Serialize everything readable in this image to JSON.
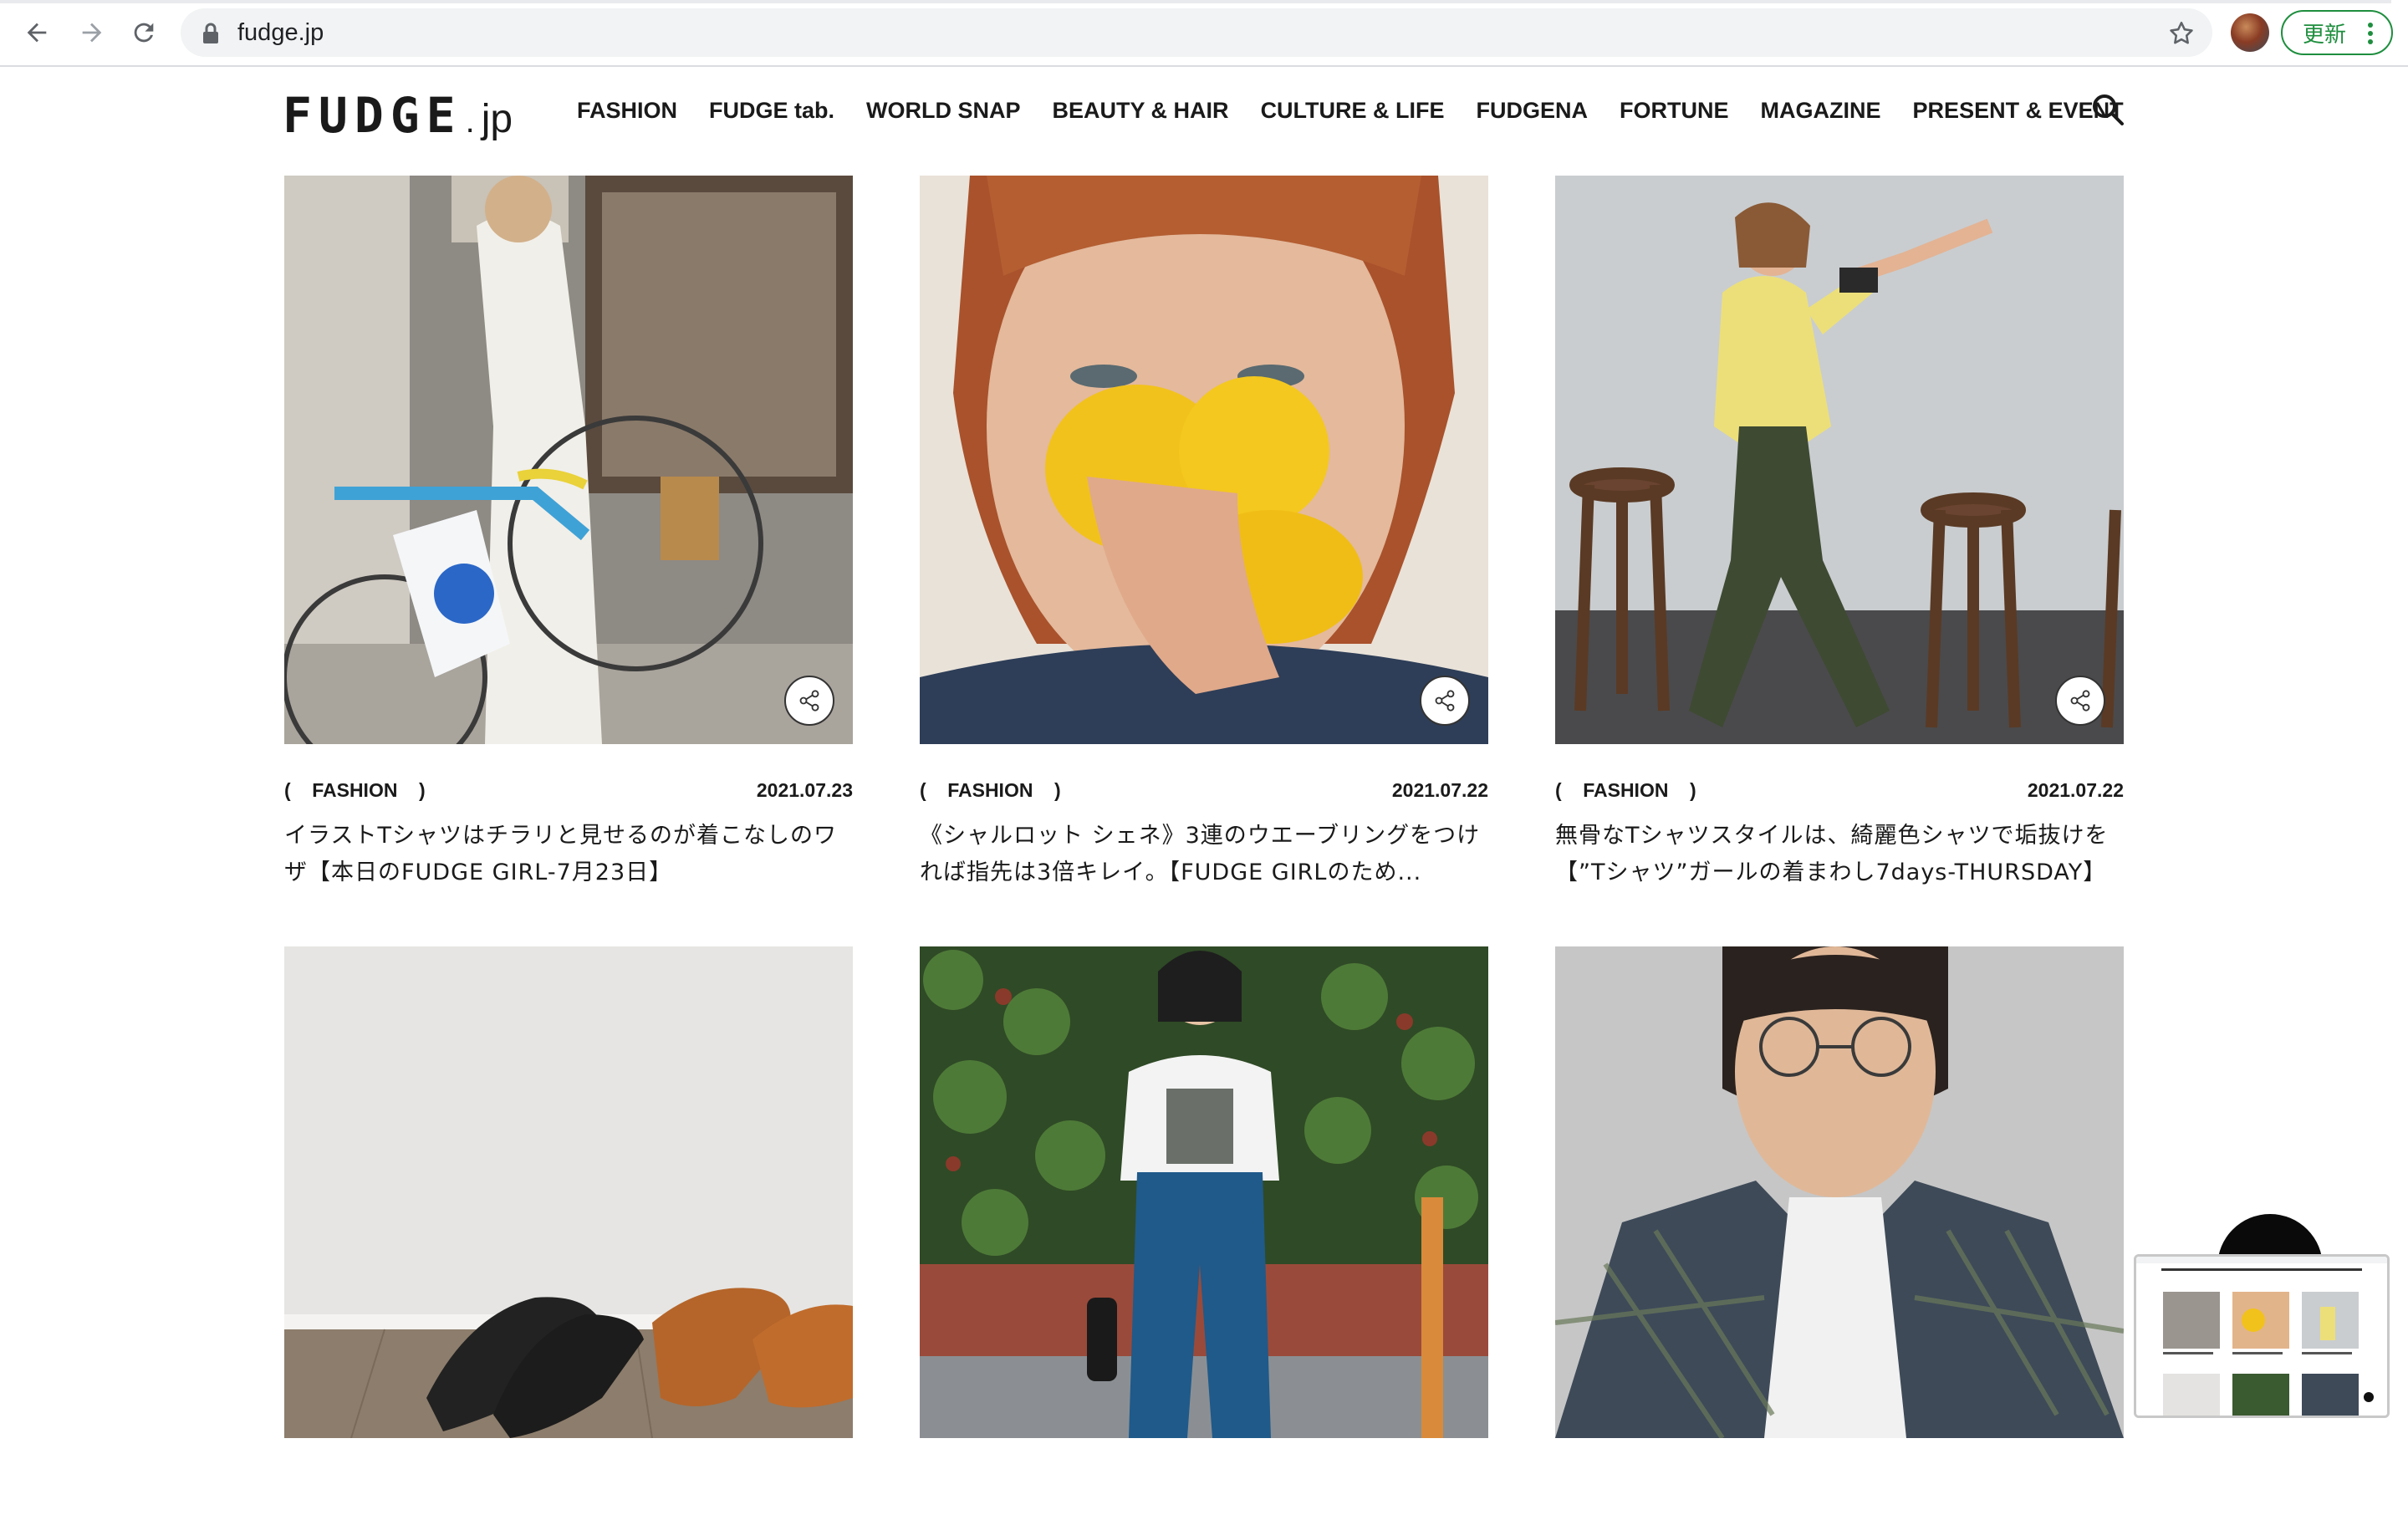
{
  "browser": {
    "url": "fudge.jp",
    "update_label": "更新"
  },
  "site": {
    "logo_main": "FUDGE",
    "logo_dot": ".",
    "logo_suffix": "jp",
    "nav": [
      {
        "label": "FASHION"
      },
      {
        "label": "FUDGE tab."
      },
      {
        "label": "WORLD SNAP"
      },
      {
        "label": "BEAUTY & HAIR"
      },
      {
        "label": "CULTURE & LIFE"
      },
      {
        "label": "FUDGENA"
      },
      {
        "label": "FORTUNE"
      },
      {
        "label": "MAGAZINE"
      },
      {
        "label": "PRESENT & EVENT"
      }
    ]
  },
  "articles": [
    {
      "category": "(    FASHION    )",
      "date": "2021.07.23",
      "title_line1": "イラストTシャツはチラリと見せるのが着こなしのワ",
      "title_line2": "ザ【本日のFUDGE GIRL-7月23日】"
    },
    {
      "category": "(    FASHION    )",
      "date": "2021.07.22",
      "title_line1": "《シャルロット シェネ》3連のウエーブリングをつけ",
      "title_line2": "れば指先は3倍キレイ。【FUDGE GIRLのため..."
    },
    {
      "category": "(    FASHION    )",
      "date": "2021.07.22",
      "title_line1": "無骨なTシャツスタイルは、綺麗色シャツで垢抜けを",
      "title_line2": "【”Tシャツ”ガールの着まわし7days-THURSDAY】"
    },
    {
      "category": "",
      "date": "",
      "title_line1": "",
      "title_line2": ""
    },
    {
      "category": "",
      "date": "",
      "title_line1": "",
      "title_line2": ""
    },
    {
      "category": "",
      "date": "",
      "title_line1": "",
      "title_line2": ""
    }
  ],
  "colors": {
    "accent_green": "#1e8e3e",
    "text": "#1a1a1a"
  }
}
